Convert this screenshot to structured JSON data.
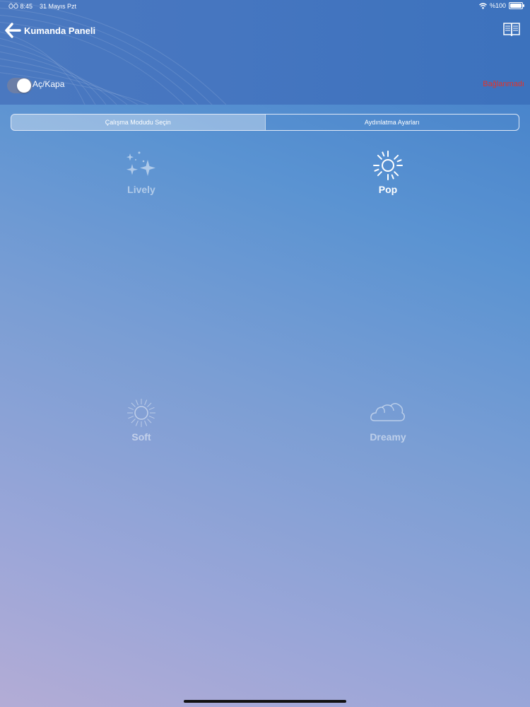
{
  "status_bar": {
    "time": "ÖÖ 8:45",
    "date": "31 Mayıs Pzt",
    "battery": "%100",
    "wifi_icon": "wifi-icon",
    "battery_icon": "battery-icon"
  },
  "nav": {
    "title": "Kumanda Paneli",
    "back_icon": "arrow-left-icon",
    "book_icon": "book-icon"
  },
  "power": {
    "label": "Aç/Kapa",
    "on": true
  },
  "connection": {
    "status": "Bağlanmadı",
    "color": "#e2332a"
  },
  "tabs": [
    {
      "label": "Çalışma Modudu Seçin",
      "active": true
    },
    {
      "label": "Aydınlatma Ayarları",
      "active": false
    }
  ],
  "modes": [
    {
      "label": "Lively",
      "icon": "sparkles-icon",
      "selected": false
    },
    {
      "label": "Pop",
      "icon": "sun-icon",
      "selected": true
    },
    {
      "label": "Soft",
      "icon": "soft-sun-icon",
      "selected": false
    },
    {
      "label": "Dreamy",
      "icon": "cloud-icon",
      "selected": false
    }
  ]
}
